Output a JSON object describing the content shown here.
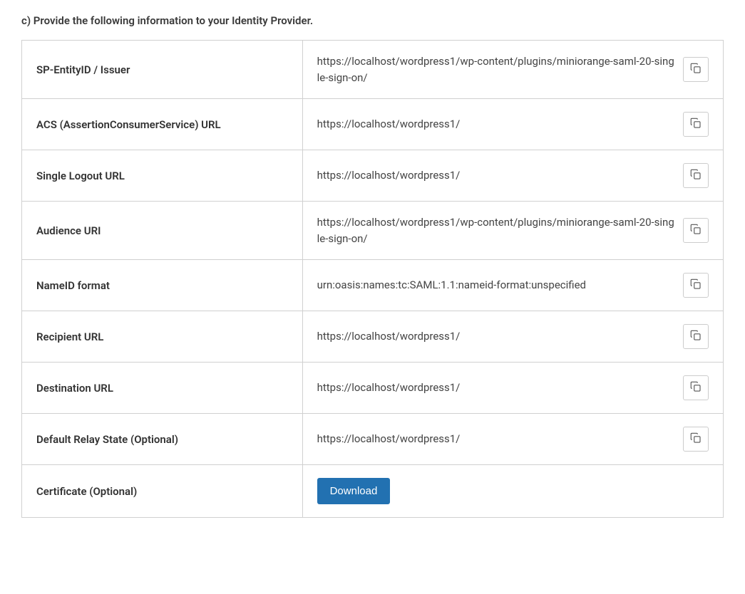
{
  "section": {
    "title": "c) Provide the following information to your Identity Provider."
  },
  "rows": [
    {
      "label": "SP-EntityID / Issuer",
      "value": "https://localhost/wordpress1/wp-content/plugins/miniorange-saml-20-single-sign-on/",
      "copy": true
    },
    {
      "label": "ACS (AssertionConsumerService) URL",
      "value": "https://localhost/wordpress1/",
      "copy": true
    },
    {
      "label": "Single Logout URL",
      "value": "https://localhost/wordpress1/",
      "copy": true
    },
    {
      "label": "Audience URI",
      "value": "https://localhost/wordpress1/wp-content/plugins/miniorange-saml-20-single-sign-on/",
      "copy": true
    },
    {
      "label": "NameID format",
      "value": "urn:oasis:names:tc:SAML:1.1:nameid-format:unspecified",
      "copy": true
    },
    {
      "label": "Recipient URL",
      "value": "https://localhost/wordpress1/",
      "copy": true
    },
    {
      "label": "Destination URL",
      "value": "https://localhost/wordpress1/",
      "copy": true
    },
    {
      "label": "Default Relay State (Optional)",
      "value": "https://localhost/wordpress1/",
      "copy": true
    },
    {
      "label": "Certificate (Optional)",
      "button": "Download"
    }
  ]
}
